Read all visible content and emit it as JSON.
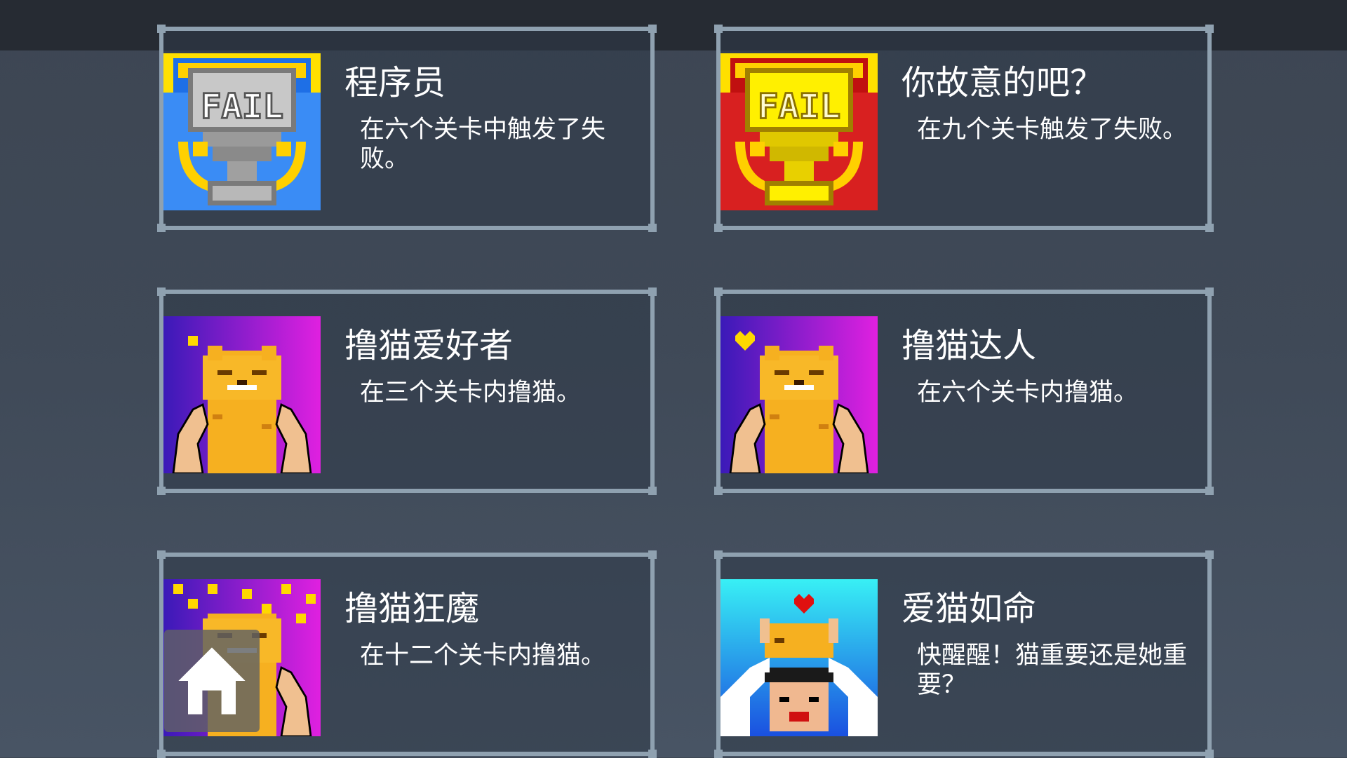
{
  "achievements": [
    {
      "title": "程序员",
      "description": "在六个关卡中触发了失败。",
      "icon": "silver-fail-trophy-icon",
      "trophy_text": "FAIL",
      "colors": {
        "bg": "#1e6fe6",
        "trophy": "#b8b8b8"
      }
    },
    {
      "title": "你故意的吧？",
      "description": "在九个关卡触发了失败。",
      "icon": "gold-fail-trophy-icon",
      "trophy_text": "FAIL",
      "colors": {
        "bg": "#d11818",
        "trophy": "#ffe800"
      }
    },
    {
      "title": "撸猫爱好者",
      "description": "在三个关卡内撸猫。",
      "icon": "petting-cat-icon",
      "colors": {
        "bg": "#5a22c8",
        "cat": "#f6b020"
      }
    },
    {
      "title": "撸猫达人",
      "description": "在六个关卡内撸猫。",
      "icon": "petting-cat-icon",
      "colors": {
        "bg": "#5a22c8",
        "cat": "#f6b020"
      }
    },
    {
      "title": "撸猫狂魔",
      "description": "在十二个关卡内撸猫。",
      "icon": "petting-cat-many-hearts-icon",
      "colors": {
        "bg": "#5a22c8",
        "cat": "#f6b020"
      }
    },
    {
      "title": "爱猫如命",
      "description": "快醒醒！猫重要还是她重要？",
      "icon": "cat-on-head-icon",
      "colors": {
        "bg": "#36e8f0",
        "cat": "#f6b020"
      }
    }
  ],
  "home_button": {
    "icon": "home-icon"
  },
  "colors": {
    "card_border": "#8fa1b0",
    "top_bar": "#262b33"
  }
}
